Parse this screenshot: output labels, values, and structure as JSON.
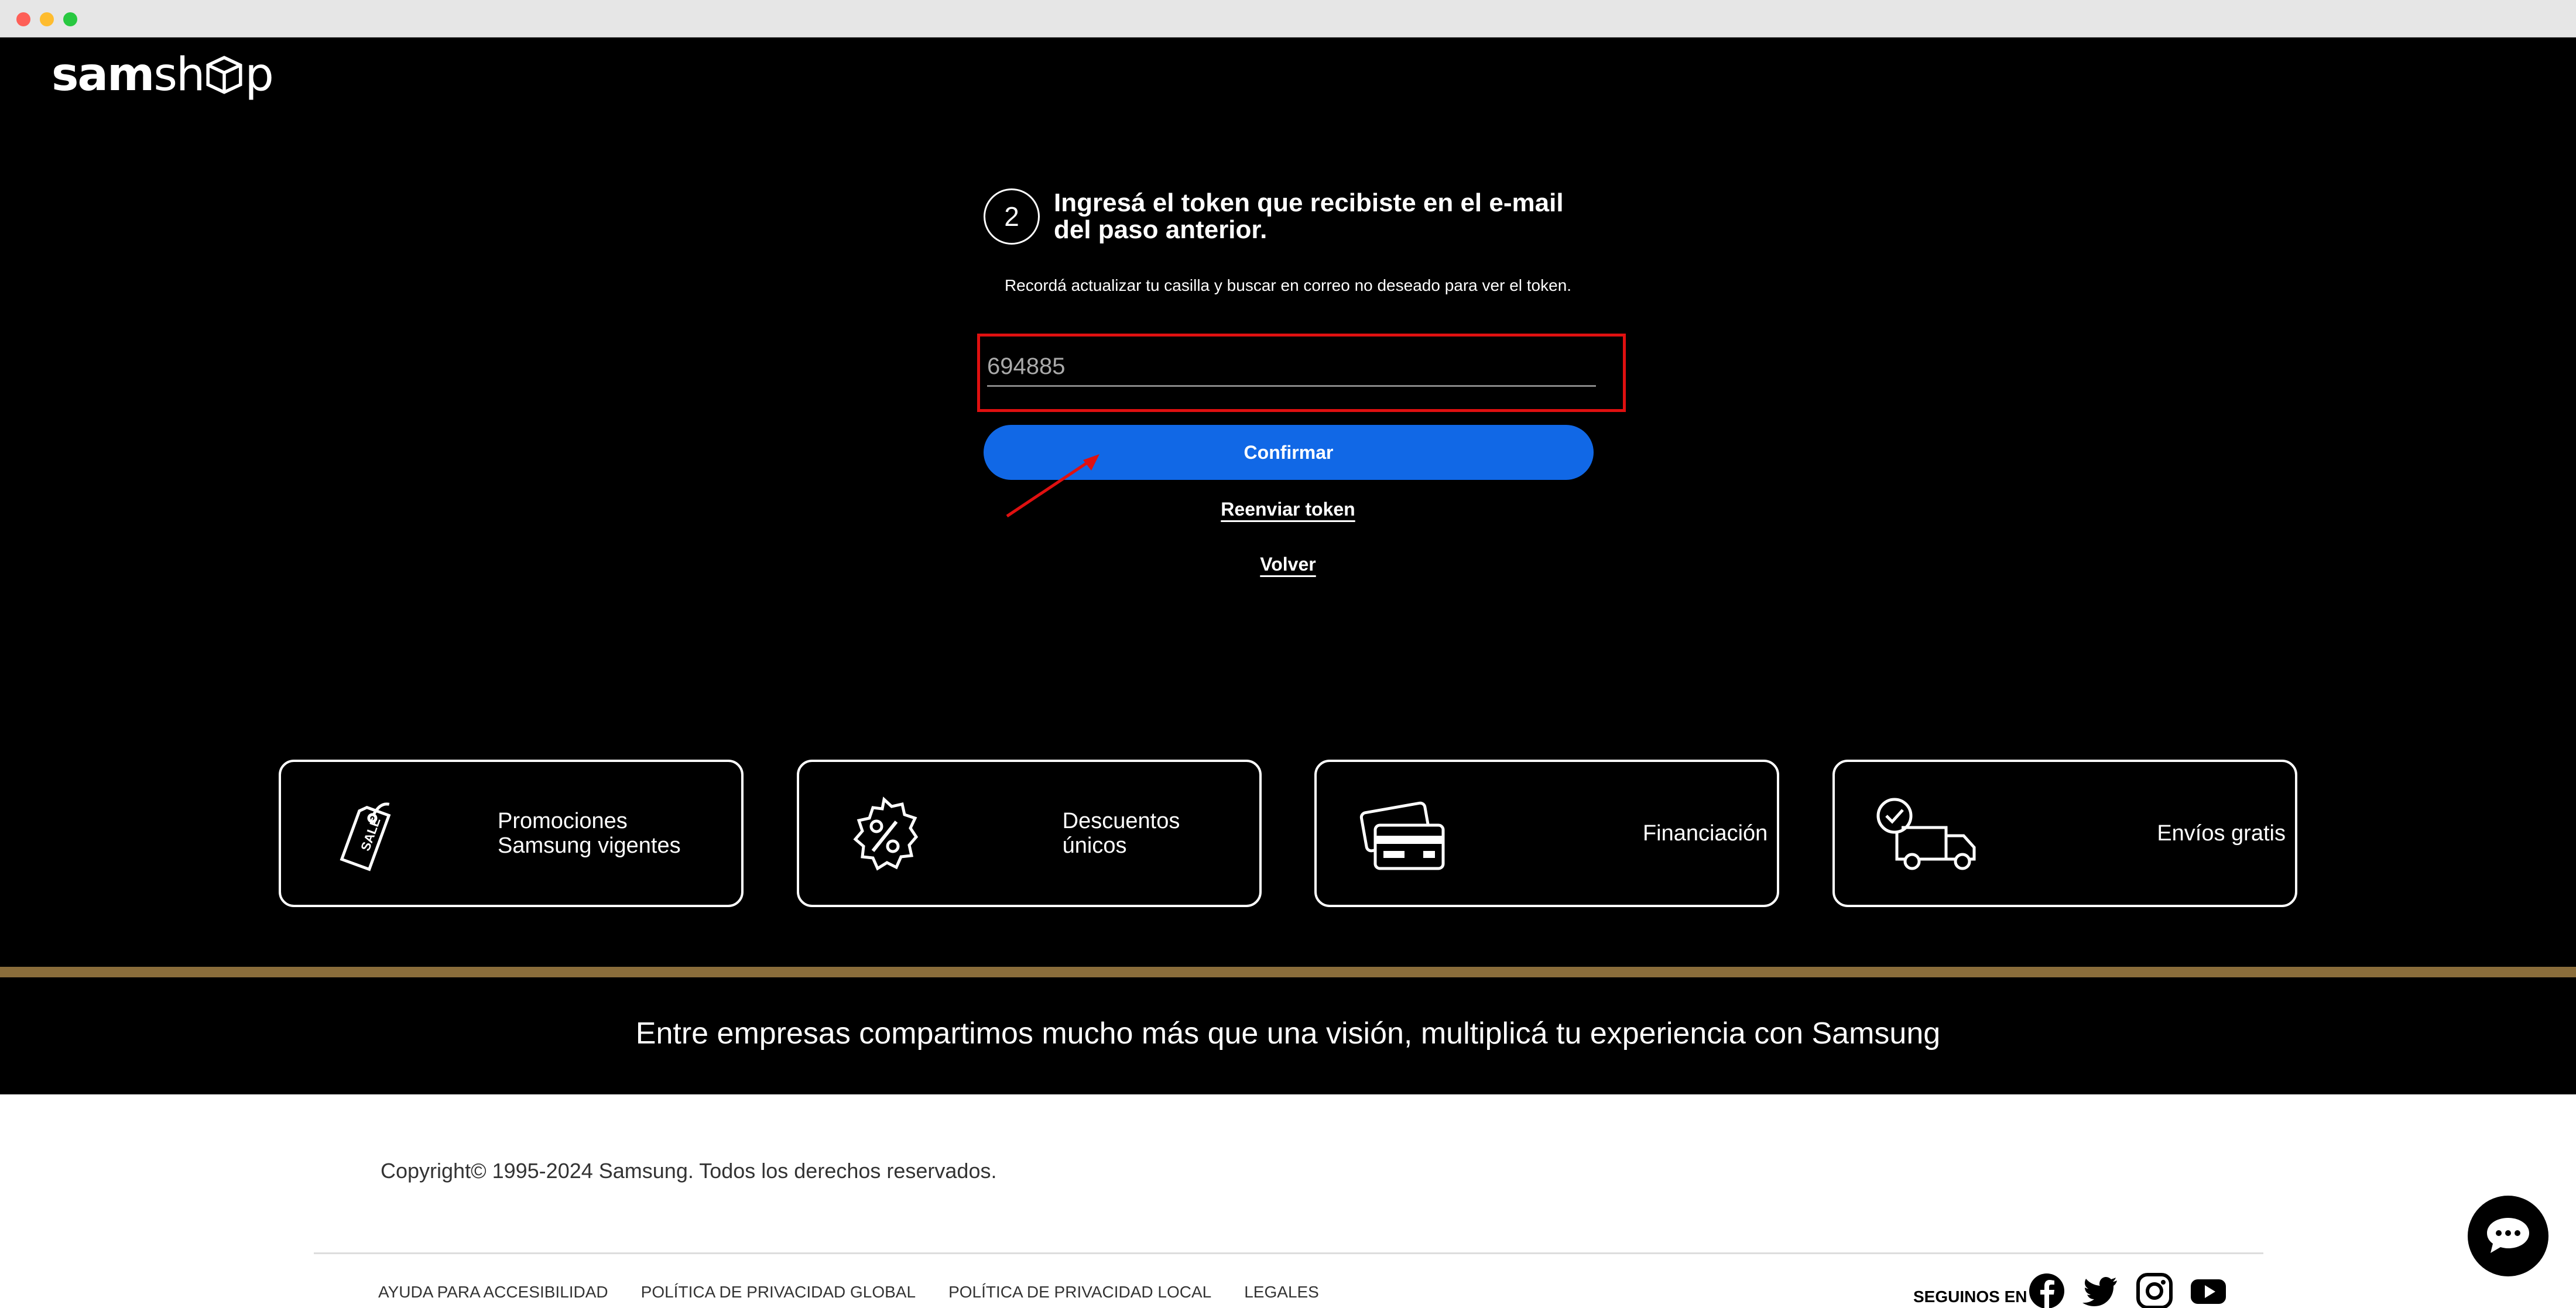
{
  "brand": {
    "logo_part1": "sam",
    "logo_part2": "sh",
    "logo_part3": "p"
  },
  "step": {
    "number": "2",
    "title": "Ingresá el token que recibiste en el e-mail del paso anterior.",
    "hint": "Recordá actualizar tu casilla y buscar en correo no deseado para ver el token."
  },
  "token": {
    "value": "694885"
  },
  "buttons": {
    "confirm": "Confirmar",
    "resend": "Reenviar token",
    "back": "Volver"
  },
  "features": [
    {
      "icon": "sale-tag-icon",
      "label": "Promociones Samsung vigentes"
    },
    {
      "icon": "percent-badge-icon",
      "label": "Descuentos únicos"
    },
    {
      "icon": "credit-cards-icon",
      "label": "Financiación"
    },
    {
      "icon": "delivery-truck-icon",
      "label": "Envíos gratis"
    }
  ],
  "tagline": "Entre empresas compartimos mucho más que una visión, multiplicá tu experiencia con Samsung",
  "footer": {
    "copyright": "Copyright© 1995-2024 Samsung. Todos los derechos reservados.",
    "links": [
      "AYUDA PARA ACCESIBILIDAD",
      "POLÍTICA DE PRIVACIDAD GLOBAL",
      "POLÍTICA DE PRIVACIDAD LOCAL",
      "LEGALES"
    ],
    "follow": "SEGUINOS EN",
    "social": [
      "facebook-icon",
      "twitter-icon",
      "instagram-icon",
      "youtube-icon"
    ]
  },
  "colors": {
    "accent": "#1168e6",
    "highlight": "#e01010",
    "band": "#8a6d3b"
  }
}
